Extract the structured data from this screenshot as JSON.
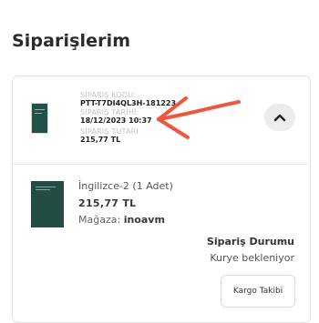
{
  "header": {
    "title": "Siparişlerim"
  },
  "order": {
    "order_code_label": "SİPARİŞ KODU:",
    "order_code": "PTT-T7DI4QL3H-181223",
    "order_date_label": "SİPARİŞ TARİHİ:",
    "order_date": "18/12/2023 10:37",
    "order_total_label": "SİPARİŞ TUTARI",
    "order_total": "215,77 TL",
    "collapse_icon": "chevron-up-icon"
  },
  "product": {
    "name": "İngilizce-2 (1 Adet)",
    "price": "215,77 TL",
    "store_label": "Mağaza:",
    "store_name": "inoavm"
  },
  "status": {
    "title": "Sipariş Durumu",
    "value": "Kurye bekleniyor",
    "tracking_button": "Kargo Takibi"
  },
  "colors": {
    "annotation_arrow": "#f0553f",
    "book_cover": "#234c44"
  }
}
